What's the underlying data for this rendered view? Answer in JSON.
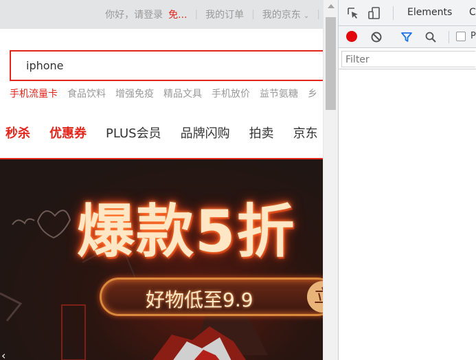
{
  "page": {
    "topbar": {
      "greeting": "你好，请登录",
      "register": "免...",
      "my_orders": "我的订单",
      "my_jd": "我的京东"
    },
    "search": {
      "value": "iphone"
    },
    "hotwords": [
      "手机流量卡",
      "食品饮料",
      "增强免疫",
      "精品文具",
      "手机放价",
      "益节氨糖",
      "乡"
    ],
    "nav": [
      "秒杀",
      "优惠券",
      "PLUS会员",
      "品牌闪购",
      "拍卖",
      "京东"
    ],
    "banner": {
      "title": "爆款5折",
      "subtitle": "好物低至9.9",
      "pill_end": "立",
      "prev_arrow": "‹"
    },
    "colors": {
      "brand_red": "#e1251b"
    }
  },
  "devtools": {
    "tabs": [
      "Elements",
      "Co"
    ],
    "icons": [
      "inspect-element-icon",
      "device-toolbar-icon",
      "record-icon",
      "clear-icon",
      "filter-icon",
      "search-icon"
    ],
    "preserve_log_label": "P",
    "filter": {
      "placeholder": "Filter"
    }
  }
}
